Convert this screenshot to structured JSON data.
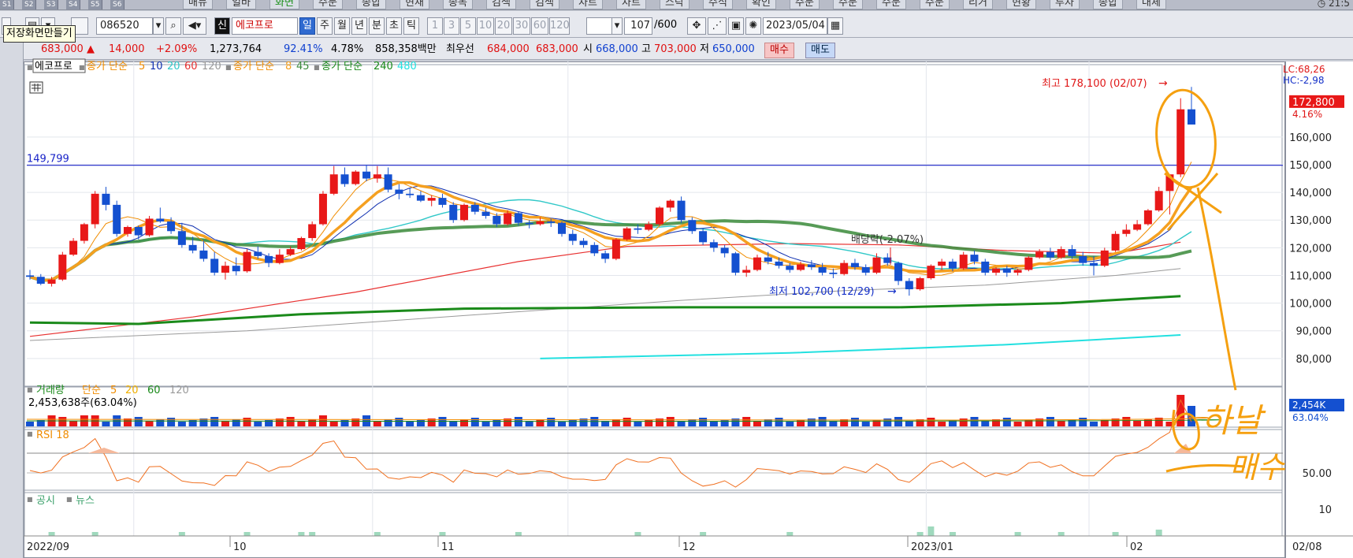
{
  "top_tabs": {
    "small": [
      "S1",
      "S2",
      "S3",
      "S4",
      "S5",
      "S6"
    ],
    "main": [
      "매뉴",
      "일바",
      "화면",
      "주문",
      "종합",
      "현재",
      "종목",
      "검색",
      "검색",
      "차트",
      "차트",
      "스탁",
      "주식",
      "확인",
      "주문",
      "주문",
      "주문",
      "주문",
      "리거",
      "현황",
      "투자",
      "종합",
      "대체"
    ],
    "clock": "21:5"
  },
  "toolbar": {
    "code": "086520",
    "name": "에코프로",
    "shin": "신",
    "periods": [
      "일",
      "주",
      "월",
      "년",
      "분",
      "초",
      "틱"
    ],
    "minutes": [
      "1",
      "3",
      "5",
      "10",
      "20",
      "30",
      "60",
      "120"
    ],
    "count": "107",
    "count_total": "/600",
    "date": "2023/05/04",
    "tooltip": "저장화면만들기"
  },
  "quote": {
    "price": "683,000",
    "change": "14,000",
    "change_pct": "+2.09%",
    "volume": "1,273,764",
    "ratio1": "92.41%",
    "ratio2": "4.78%",
    "amount": "858,358백만",
    "best_label": "최우선",
    "best_ask": "684,000",
    "best_bid": "683,000",
    "open_label": "시",
    "open": "668,000",
    "high_label": "고",
    "high": "703,000",
    "low_label": "저",
    "low": "650,000",
    "buy": "매수",
    "sell": "매도"
  },
  "chart_data": {
    "type": "candlestick",
    "legend": {
      "name": "에코프로",
      "ma_main": "종가 단순",
      "ma_main_periods": [
        "5",
        "10",
        "20",
        "60",
        "120"
      ],
      "ma2": "종가 단순",
      "ma2_periods": [
        "8",
        "45"
      ],
      "ma3": "종가 단순",
      "ma3_periods": [
        "240",
        "480"
      ]
    },
    "ylim": [
      70000,
      185000
    ],
    "yticks": [
      160000,
      150000,
      140000,
      130000,
      120000,
      110000,
      100000,
      90000,
      80000
    ],
    "ytick_labels": [
      "160,000",
      "150,000",
      "140,000",
      "130,000",
      "120,000",
      "110,000",
      "100,000",
      "90,000",
      "80,000"
    ],
    "hline": 149799,
    "hline_label": "149,799",
    "lc_label": "LC:68,26",
    "hc_label": "HC:-2,98",
    "last_label": "172,800",
    "last_pct": "4.16%",
    "last_value": 172800,
    "annotations": {
      "high": "최고 178,100 (02/07)",
      "low": "최저 102,700 (12/29)",
      "dividend": "배당락(-2.07%)"
    },
    "x_labels": [
      "2022/09",
      "10",
      "11",
      "12",
      "2023/01",
      "02",
      "02/08"
    ],
    "candles": [
      [
        110000,
        112000,
        108500,
        109500
      ],
      [
        109500,
        110500,
        106500,
        107000
      ],
      [
        107000,
        109500,
        106000,
        108500
      ],
      [
        108500,
        118500,
        108000,
        117500
      ],
      [
        117500,
        123500,
        117000,
        122500
      ],
      [
        122500,
        129000,
        121500,
        128500
      ],
      [
        128500,
        140500,
        127000,
        139500
      ],
      [
        139500,
        142000,
        133500,
        135500
      ],
      [
        135500,
        137000,
        124000,
        125000
      ],
      [
        125000,
        128000,
        124000,
        127500
      ],
      [
        127500,
        128000,
        123000,
        124500
      ],
      [
        124500,
        131500,
        124000,
        130500
      ],
      [
        130500,
        134500,
        129000,
        129500
      ],
      [
        129500,
        131000,
        125000,
        126000
      ],
      [
        126000,
        129000,
        120000,
        121000
      ],
      [
        121000,
        124000,
        118000,
        119000
      ],
      [
        119000,
        122500,
        115000,
        116000
      ],
      [
        116000,
        118500,
        110000,
        111000
      ],
      [
        111000,
        115000,
        108500,
        113500
      ],
      [
        113500,
        116500,
        110000,
        111500
      ],
      [
        111500,
        119500,
        111000,
        118500
      ],
      [
        118500,
        120500,
        116000,
        117000
      ],
      [
        117000,
        118000,
        113000,
        114500
      ],
      [
        114500,
        119500,
        114000,
        117500
      ],
      [
        117500,
        120500,
        117000,
        119500
      ],
      [
        119500,
        124000,
        119000,
        123500
      ],
      [
        123500,
        129500,
        122500,
        128500
      ],
      [
        128500,
        140500,
        128000,
        139500
      ],
      [
        139500,
        149500,
        139000,
        146500
      ],
      [
        146500,
        149000,
        142000,
        143000
      ],
      [
        143000,
        148000,
        142500,
        147500
      ],
      [
        147500,
        150000,
        144000,
        145000
      ],
      [
        145000,
        149500,
        143500,
        146500
      ],
      [
        146500,
        149000,
        140000,
        141000
      ],
      [
        141000,
        143000,
        137500,
        139500
      ],
      [
        139500,
        141500,
        138000,
        139000
      ],
      [
        139000,
        140500,
        136500,
        137000
      ],
      [
        137000,
        139000,
        135000,
        138000
      ],
      [
        138000,
        139500,
        134500,
        135500
      ],
      [
        135500,
        136500,
        129000,
        130000
      ],
      [
        130000,
        136000,
        129500,
        135500
      ],
      [
        135500,
        136500,
        132000,
        133000
      ],
      [
        133000,
        134500,
        130500,
        131500
      ],
      [
        131500,
        132500,
        127500,
        128500
      ],
      [
        128500,
        133500,
        128000,
        132500
      ],
      [
        132500,
        133000,
        128000,
        129000
      ],
      [
        129000,
        130000,
        127000,
        128500
      ],
      [
        128500,
        131000,
        128000,
        129500
      ],
      [
        129500,
        130500,
        127500,
        129000
      ],
      [
        129000,
        129500,
        124000,
        125000
      ],
      [
        125000,
        126500,
        121000,
        122500
      ],
      [
        122500,
        123500,
        120000,
        121000
      ],
      [
        121000,
        122000,
        117000,
        118000
      ],
      [
        118000,
        119000,
        114500,
        116000
      ],
      [
        116000,
        123500,
        115500,
        123000
      ],
      [
        123000,
        127500,
        122500,
        127000
      ],
      [
        127000,
        128500,
        125000,
        126500
      ],
      [
        126500,
        129500,
        126000,
        128500
      ],
      [
        128500,
        135000,
        128000,
        134500
      ],
      [
        134500,
        137500,
        133000,
        137000
      ],
      [
        137000,
        138500,
        129000,
        130000
      ],
      [
        130000,
        131000,
        125000,
        126000
      ],
      [
        126000,
        127000,
        121000,
        122000
      ],
      [
        122000,
        123000,
        118500,
        120000
      ],
      [
        120000,
        121000,
        116500,
        118000
      ],
      [
        118000,
        118500,
        110000,
        111000
      ],
      [
        111000,
        113500,
        109500,
        112000
      ],
      [
        112000,
        117500,
        111500,
        116500
      ],
      [
        116500,
        118500,
        114000,
        115000
      ],
      [
        115000,
        116500,
        112500,
        113500
      ],
      [
        113500,
        114500,
        111000,
        112000
      ],
      [
        112000,
        115000,
        111500,
        114000
      ],
      [
        114000,
        115500,
        112000,
        113000
      ],
      [
        113000,
        114500,
        110000,
        111000
      ],
      [
        111000,
        112500,
        109000,
        110500
      ],
      [
        110500,
        115500,
        110000,
        114500
      ],
      [
        114500,
        116000,
        112000,
        113000
      ],
      [
        113000,
        114000,
        110000,
        111000
      ],
      [
        111000,
        118000,
        110500,
        116500
      ],
      [
        116500,
        118000,
        113500,
        114500
      ],
      [
        114500,
        115000,
        106500,
        108000
      ],
      [
        108000,
        109000,
        102700,
        105000
      ],
      [
        105000,
        109500,
        104500,
        109000
      ],
      [
        109000,
        114000,
        108500,
        113500
      ],
      [
        113500,
        116000,
        112000,
        115000
      ],
      [
        115000,
        116000,
        111500,
        112500
      ],
      [
        112500,
        118500,
        112000,
        117500
      ],
      [
        117500,
        119000,
        114000,
        115000
      ],
      [
        115000,
        116000,
        110000,
        111000
      ],
      [
        111000,
        113000,
        110000,
        112500
      ],
      [
        112500,
        113500,
        109500,
        111000
      ],
      [
        111000,
        112500,
        110000,
        112000
      ],
      [
        112000,
        117000,
        111500,
        116500
      ],
      [
        116500,
        119500,
        116000,
        118500
      ],
      [
        118500,
        120000,
        115500,
        116500
      ],
      [
        116500,
        120500,
        116000,
        119500
      ],
      [
        119500,
        121000,
        116000,
        117000
      ],
      [
        117000,
        118500,
        113500,
        114500
      ],
      [
        114500,
        117000,
        110000,
        113500
      ],
      [
        113500,
        120000,
        113000,
        119000
      ],
      [
        119000,
        126000,
        118500,
        125000
      ],
      [
        125000,
        128500,
        124000,
        126500
      ],
      [
        126500,
        130000,
        126000,
        128500
      ],
      [
        128500,
        134000,
        128000,
        133500
      ],
      [
        133500,
        142000,
        133000,
        140500
      ],
      [
        140500,
        146000,
        132000,
        146500
      ],
      [
        146500,
        174000,
        145500,
        170000
      ],
      [
        170000,
        178100,
        166000,
        164500
      ]
    ],
    "volume_label": "거래량",
    "volume_ma": "단순",
    "volume_ma_periods": [
      "5",
      "20",
      "60",
      "120"
    ],
    "volume_value": "2,453,638주(63.04%)",
    "volume_axis_label": "2,454K",
    "volume_axis_pct": "63.04%",
    "rsi_label": "RSI 18",
    "rsi_axis_label": "50.00",
    "news_label": "공시",
    "news_label2": "뉴스",
    "news_axis_label": "10",
    "handwriting": "하날 매수"
  }
}
